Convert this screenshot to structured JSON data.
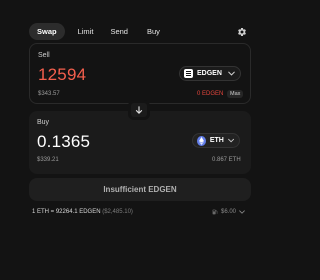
{
  "tabs": [
    {
      "label": "Swap"
    },
    {
      "label": "Limit"
    },
    {
      "label": "Send"
    },
    {
      "label": "Buy"
    }
  ],
  "icons": {
    "settings": "gear-icon",
    "switch": "arrow-down-icon",
    "gas": "gas-pump-icon"
  },
  "sell": {
    "label": "Sell",
    "amount": "12594",
    "fiat": "$343.57",
    "token": "EDGEN",
    "balance": "0 EDGEN",
    "max_label": "Max"
  },
  "buy": {
    "label": "Buy",
    "amount": "0.1365",
    "fiat": "$339.21",
    "token": "ETH",
    "balance": "0.867 ETH"
  },
  "submit_label": "Insufficient EDGEN",
  "rate": {
    "text": "1 ETH = 92264.1 EDGEN",
    "fiat": "($2,485.10)"
  },
  "gas_fee": "$6.00",
  "colors": {
    "background": "#131313",
    "sell_amount": "#f45f4d",
    "insufficient_balance": "#e6453c",
    "eth_brand": "#627eea"
  }
}
